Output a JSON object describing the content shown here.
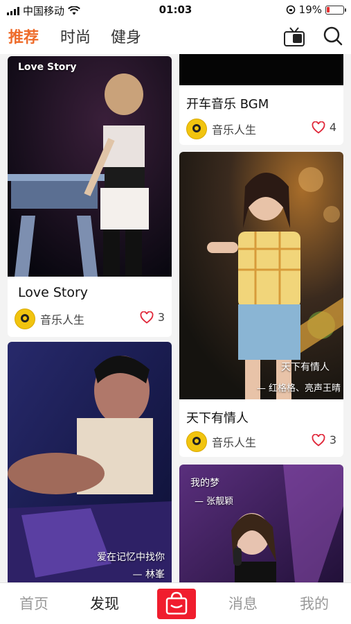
{
  "status": {
    "carrier": "中国移动",
    "time": "01:03",
    "battery": "19%",
    "battery_level": 0.19
  },
  "topnav": {
    "tabs": [
      {
        "label": "推荐",
        "active": true
      },
      {
        "label": "时尚",
        "active": false
      },
      {
        "label": "健身",
        "active": false
      }
    ],
    "tv_icon": "tv-icon",
    "search_icon": "search-icon"
  },
  "feed": {
    "left": [
      {
        "image_caption": "Love Story",
        "title": "Love Story",
        "author": "音乐人生",
        "likes": "3"
      },
      {
        "overlay_line1": "爱在记忆中找你",
        "overlay_line2": "— 林峯"
      }
    ],
    "right": [
      {
        "title": "开车音乐 BGM",
        "author": "音乐人生",
        "likes": "4"
      },
      {
        "overlay_line1": "天下有情人",
        "overlay_line2": "— 红格格、亮声王晴",
        "title": "天下有情人",
        "author": "音乐人生",
        "likes": "3"
      },
      {
        "overlay_line1": "我的梦",
        "overlay_line2": "— 张靓颖"
      }
    ]
  },
  "bottombar": {
    "items": [
      {
        "label": "首页",
        "active": false
      },
      {
        "label": "发现",
        "active": true
      },
      {
        "label": "消息",
        "active": false
      },
      {
        "label": "我的",
        "active": false
      }
    ],
    "center_icon": "shopping-bag-icon",
    "accent": "#f01d2d"
  },
  "colors": {
    "accent": "#ee6b2a",
    "heart": "#e0283a",
    "avatar": "#f1c40f"
  }
}
